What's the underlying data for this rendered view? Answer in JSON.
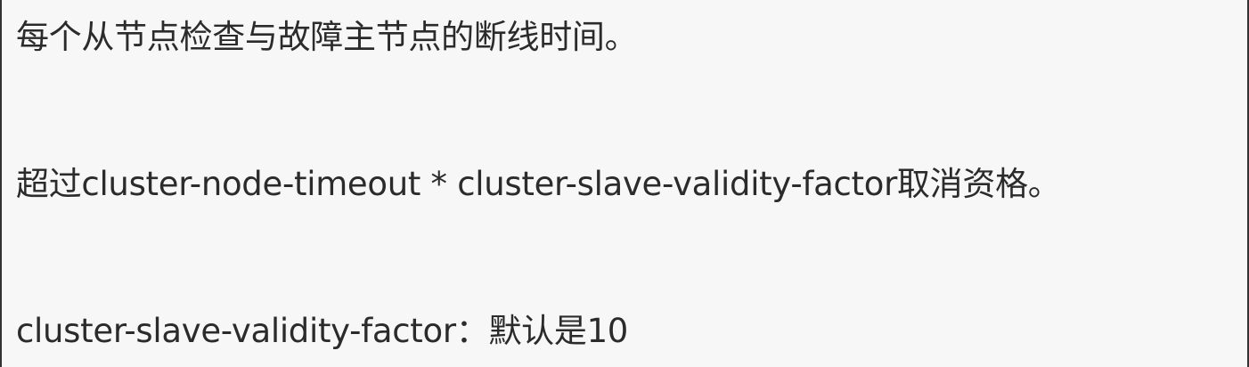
{
  "content": {
    "lines": [
      "每个从节点检查与故障主节点的断线时间。",
      "超过cluster-node-timeout * cluster-slave-validity-factor取消资格。",
      "cluster-slave-validity-factor：默认是10"
    ]
  }
}
